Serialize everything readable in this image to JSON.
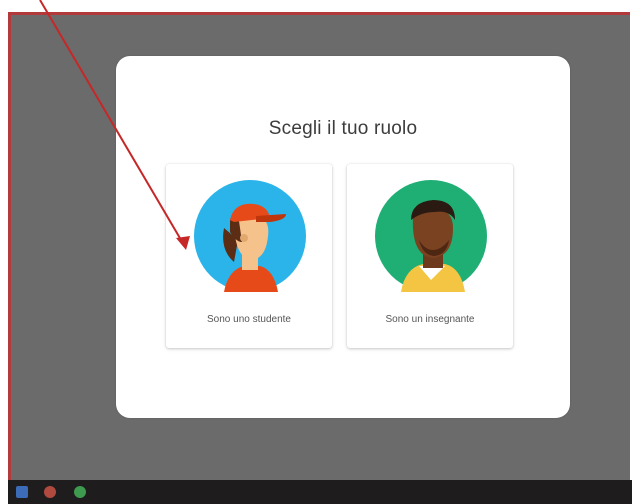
{
  "dialog": {
    "title": "Scegli il tuo ruolo",
    "roles": [
      {
        "label": "Sono uno studente",
        "icon": "student-icon",
        "color": "#2bb4ea"
      },
      {
        "label": "Sono un insegnante",
        "icon": "teacher-icon",
        "color": "#1fae74"
      }
    ]
  },
  "annotation": {
    "arrow_color": "#c62828"
  },
  "frame": {
    "border_color": "#b23a3a",
    "background": "#6b6b6b"
  }
}
